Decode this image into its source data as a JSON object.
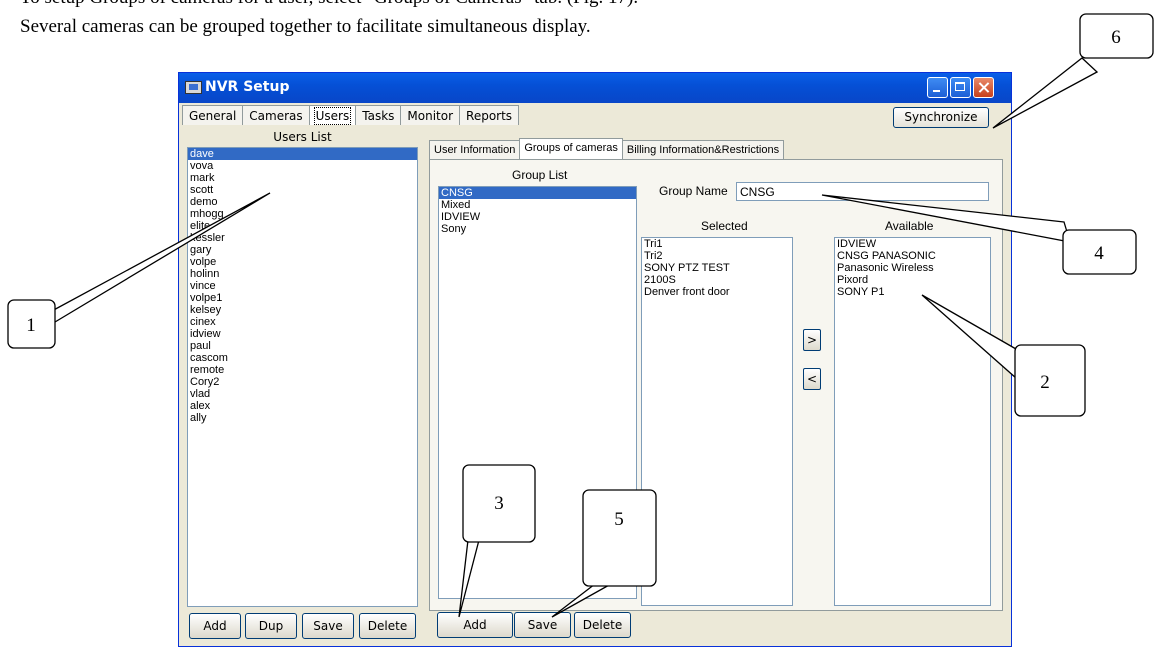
{
  "document": {
    "line1": "To setup Groups of cameras for a user, select \"Groups of Cameras\" tab. (Fig. 17).",
    "line2": "Several cameras can be grouped together to facilitate simultaneous display."
  },
  "callouts": [
    "1",
    "2",
    "3",
    "4",
    "5",
    "6"
  ],
  "window": {
    "title": "NVR Setup",
    "tabs": [
      "General",
      "Cameras",
      "Users",
      "Tasks",
      "Monitor",
      "Reports"
    ],
    "active_tab": "Users",
    "synchronize_label": "Synchronize"
  },
  "users": {
    "header": "Users List",
    "items": [
      "dave",
      "vova",
      "mark",
      "scott",
      "demo",
      "mhogg",
      "elite",
      "kessler",
      "gary",
      "volpe",
      "holinn",
      "vince",
      "volpe1",
      "kelsey",
      "cinex",
      "idview",
      "paul",
      "cascom",
      "remote",
      "Cory2",
      "vlad",
      "alex",
      "ally"
    ],
    "selected": "dave",
    "buttons": {
      "add": "Add",
      "dup": "Dup",
      "save": "Save",
      "delete": "Delete"
    }
  },
  "subtabs": [
    "User Information",
    "Groups of cameras",
    "Billing Information&Restrictions"
  ],
  "active_subtab": "Groups of cameras",
  "groups": {
    "header": "Group List",
    "items": [
      "CNSG",
      "Mixed",
      "IDVIEW",
      "Sony"
    ],
    "selected": "CNSG",
    "group_name_label": "Group Name",
    "group_name_value": "CNSG",
    "selected_header": "Selected",
    "selected_items": [
      "Tri1",
      "Tri2",
      "SONY PTZ TEST",
      "2100S",
      "Denver front door"
    ],
    "available_header": "Available",
    "available_items": [
      "IDVIEW",
      "CNSG PANASONIC",
      "Panasonic Wireless",
      "Pixord",
      "SONY P1"
    ],
    "move_right": ">",
    "move_left": "<",
    "buttons": {
      "add": "Add",
      "save": "Save",
      "delete": "Delete"
    }
  }
}
